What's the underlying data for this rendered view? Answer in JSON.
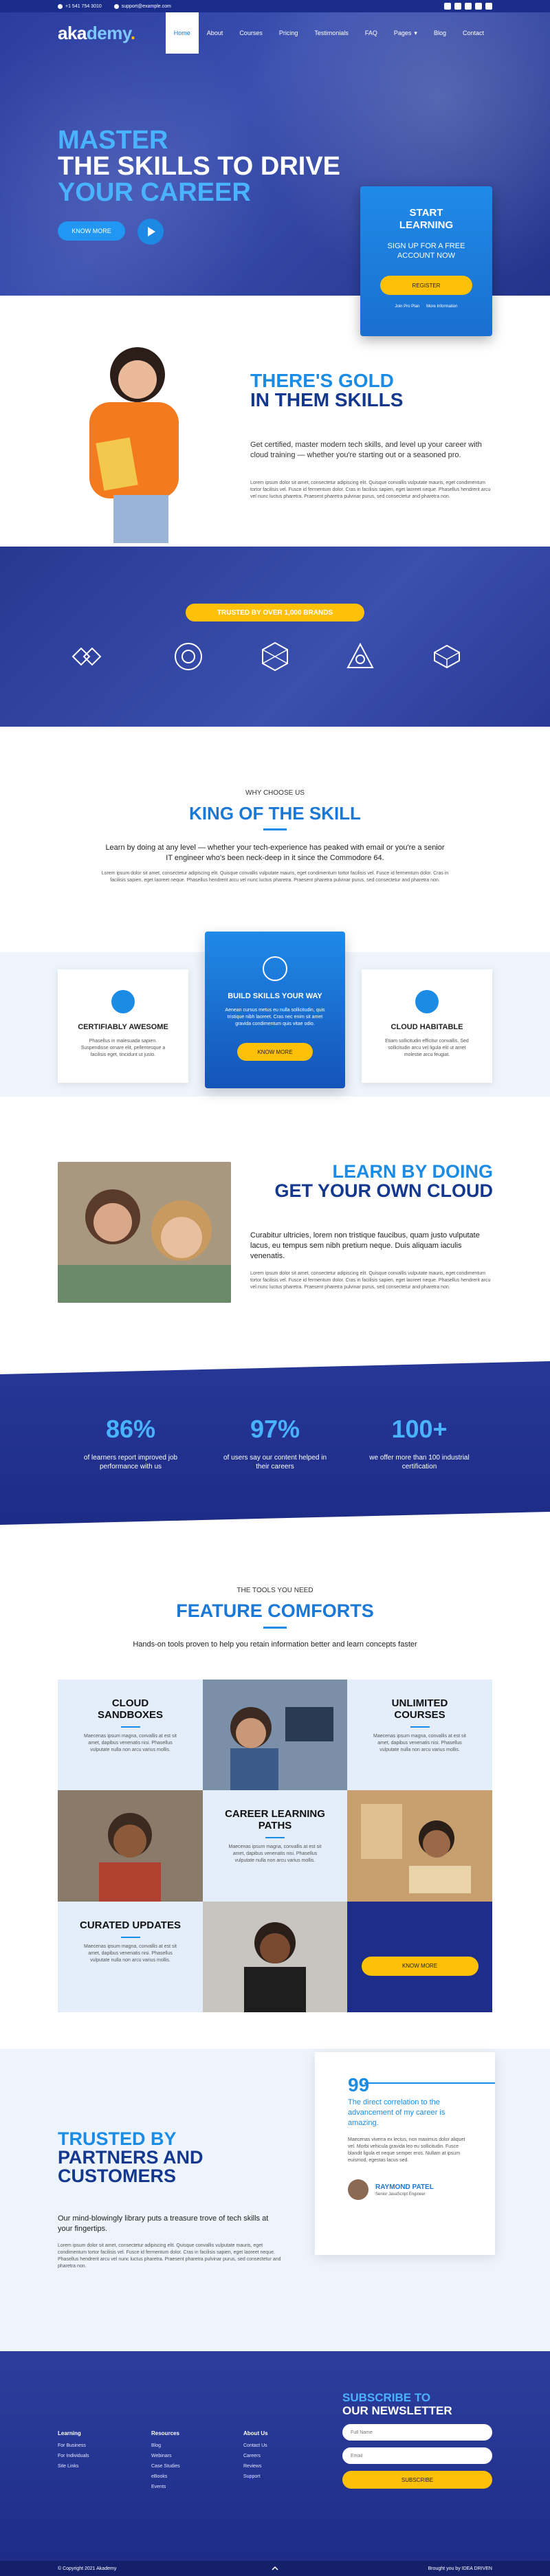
{
  "topbar": {
    "phone": "+1 541 754 3010",
    "email": "support@example.com"
  },
  "nav": {
    "logo_a": "aka",
    "logo_b": "demy",
    "logo_dot": ".",
    "items": [
      "Home",
      "About",
      "Courses",
      "Pricing",
      "Testimonials",
      "FAQ",
      "Pages",
      "Blog",
      "Contact"
    ]
  },
  "hero": {
    "line1": "MASTER",
    "line2": "THE SKILLS TO DRIVE",
    "line3": "YOUR CAREER",
    "know_more": "KNOW MORE",
    "card_title": "START LEARNING",
    "card_sub": "SIGN UP FOR A FREE ACCOUNT NOW",
    "card_btn": "REGISTER",
    "card_link1": "Join Pro Plan",
    "card_link2": "More Information"
  },
  "gold": {
    "title1": "THERE'S GOLD",
    "title2": "IN THEM SKILLS",
    "lead": "Get certified, master modern tech skills, and level up your career with cloud training — whether you're starting out or a seasoned pro.",
    "body": "Lorem ipsum dolor sit amet, consectetur adipiscing elit. Quisque convallis vulputate mauris, eget condimentum tortor facilisis vel. Fusce id fermentum dolor. Cras in facilisis sapien, eget laoreet neque. Phasellus hendrerit arcu vel nunc luctus pharetra. Praesent pharetra pulvinar purus, sed consectetur and pharetra non."
  },
  "brands": {
    "badge": "TRUSTED BY OVER 1,000 BRANDS"
  },
  "king": {
    "kicker": "WHY CHOOSE US",
    "title": "KING OF THE SKILL",
    "lead": "Learn by doing at any level — whether your tech-experience has peaked with email or you're a senior IT engineer who's been neck-deep in it since the Commodore 64.",
    "body": "Lorem ipsum dolor sit amet, consectetur adipiscing elit. Quisque convallis vulputate mauris, eget condimentum tortor facilisis vel. Fusce id fermentum dolor. Cras in facilisis sapien, eget laoreet neque. Phasellus hendrerit arcu vel nunc luctus pharetra. Praesent pharetra pulvinar purus, sed consectetur and pharetra non."
  },
  "features": {
    "left_title": "CERTIFIABLY AWESOME",
    "left_desc": "Phasellus in malesuada sapien. Suspendisse ornare elit, pellentesque a facilisis eget, tincidunt ut justo.",
    "mid_title": "BUILD SKILLS YOUR WAY",
    "mid_desc": "Aenean cursus metus eu nulla sollicitudin, quis tristique nibh laoreet. Cras nec enim sit amet gravida condimentum quis vitae odio.",
    "mid_btn": "KNOW MORE",
    "right_title": "CLOUD HABITABLE",
    "right_desc": "Etiam sollicitudin efficitur convallis. Sed sollicitudin arcu vel ligula elit ut amet molestie arcu feugiat."
  },
  "cloud": {
    "title1": "LEARN BY DOING",
    "title2": "GET YOUR OWN CLOUD",
    "lead": "Curabitur ultricies, lorem non tristique faucibus, quam justo vulputate lacus, eu tempus sem nibh pretium neque. Duis aliquam iaculis venenatis.",
    "body": "Lorem ipsum dolor sit amet, consectetur adipiscing elit. Quisque convallis vulputate mauris, eget condimentum tortor facilisis vel. Fusce id fermentum dolor. Cras in facilisis sapien, eget laoreet neque. Phasellus hendrerit arcu vel nunc luctus pharetra. Praesent pharetra pulvinar purus, sed consectetur and pharetra non."
  },
  "stats": [
    {
      "num": "86%",
      "label": "of learners report improved job performance with us"
    },
    {
      "num": "97%",
      "label": "of users say our content helped in their careers"
    },
    {
      "num": "100+",
      "label": "we offer more than 100 industrial certification"
    }
  ],
  "comforts": {
    "kicker": "THE TOOLS YOU NEED",
    "title": "FEATURE COMFORTS",
    "lead": "Hands-on tools proven to help you retain information better and learn concepts faster",
    "cells": [
      {
        "title": "CLOUD SANDBOXES",
        "desc": "Maecenas ipsum magna, convallis at est sit amet, dapibus venenatis nisi. Phasellus vulputate nulla non arcu varius mollis."
      },
      {
        "title": "UNLIMITED COURSES",
        "desc": "Maecenas ipsum magna, convallis at est sit amet, dapibus venenatis nisi. Phasellus vulputate nulla non arcu varius mollis."
      },
      {
        "title": "CAREER LEARNING PATHS",
        "desc": "Maecenas ipsum magna, convallis at est sit amet, dapibus venenatis nisi. Phasellus vulputate nulla non arcu varius mollis."
      },
      {
        "title": "CURATED UPDATES",
        "desc": "Maecenas ipsum magna, convallis at est sit amet, dapibus venenatis nisi. Phasellus vulputate nulla non arcu varius mollis."
      }
    ],
    "btn": "KNOW MORE"
  },
  "trusted": {
    "title1": "TRUSTED BY",
    "title2": "PARTNERS AND",
    "title3": "CUSTOMERS",
    "lead": "Our mind-blowingly library puts a treasure trove of tech skills at your fingertips.",
    "body": "Lorem ipsum dolor sit amet, consectetur adipiscing elit. Quisque convallis vulputate mauris, eget condimentum tortor facilisis vel. Fusce id fermentum dolor. Cras in facilisis sapien, eget laoreet neque. Phasellus hendrerit arcu vel nunc luctus pharetra. Praesent pharetra pulvinar purus, sed consectetur and pharetra non.",
    "quote_mark": "99",
    "quote": "The direct correlation to the advancement of my career is amazing.",
    "quote_body": "Maecenas viverra ex lectus, non maximus dolor aliquet vel. Morbi vehicula gravida leo eu sollicitudin. Fusce blandit ligula et neque semper eros. Nullam at ipsum euismod, egestas lacus sed.",
    "name": "RAYMOND PATEL",
    "role": "Senior JavaScript Engineer"
  },
  "footer": {
    "cols": [
      {
        "head": "Learning",
        "items": [
          "For Business",
          "For Individuals",
          "Site Links"
        ]
      },
      {
        "head": "Resources",
        "items": [
          "Blog",
          "Webinars",
          "Case Studies",
          "eBooks",
          "Events"
        ]
      },
      {
        "head": "About Us",
        "items": [
          "Contact Us",
          "Careers",
          "Reviews",
          "Support"
        ]
      }
    ],
    "sub1": "SUBSCRIBE TO",
    "sub2": "OUR NEWSLETTER",
    "name_ph": "Full Name",
    "email_ph": "Email",
    "sub_btn": "SUBSCRIBE",
    "copyright": "© Copyright 2021 Akademy",
    "credit": "Brought you by IDEA DRIVEN"
  },
  "colors": {
    "navy": "#1e2d8a",
    "accent": "#1a8ce6",
    "gold": "#ffc107"
  }
}
